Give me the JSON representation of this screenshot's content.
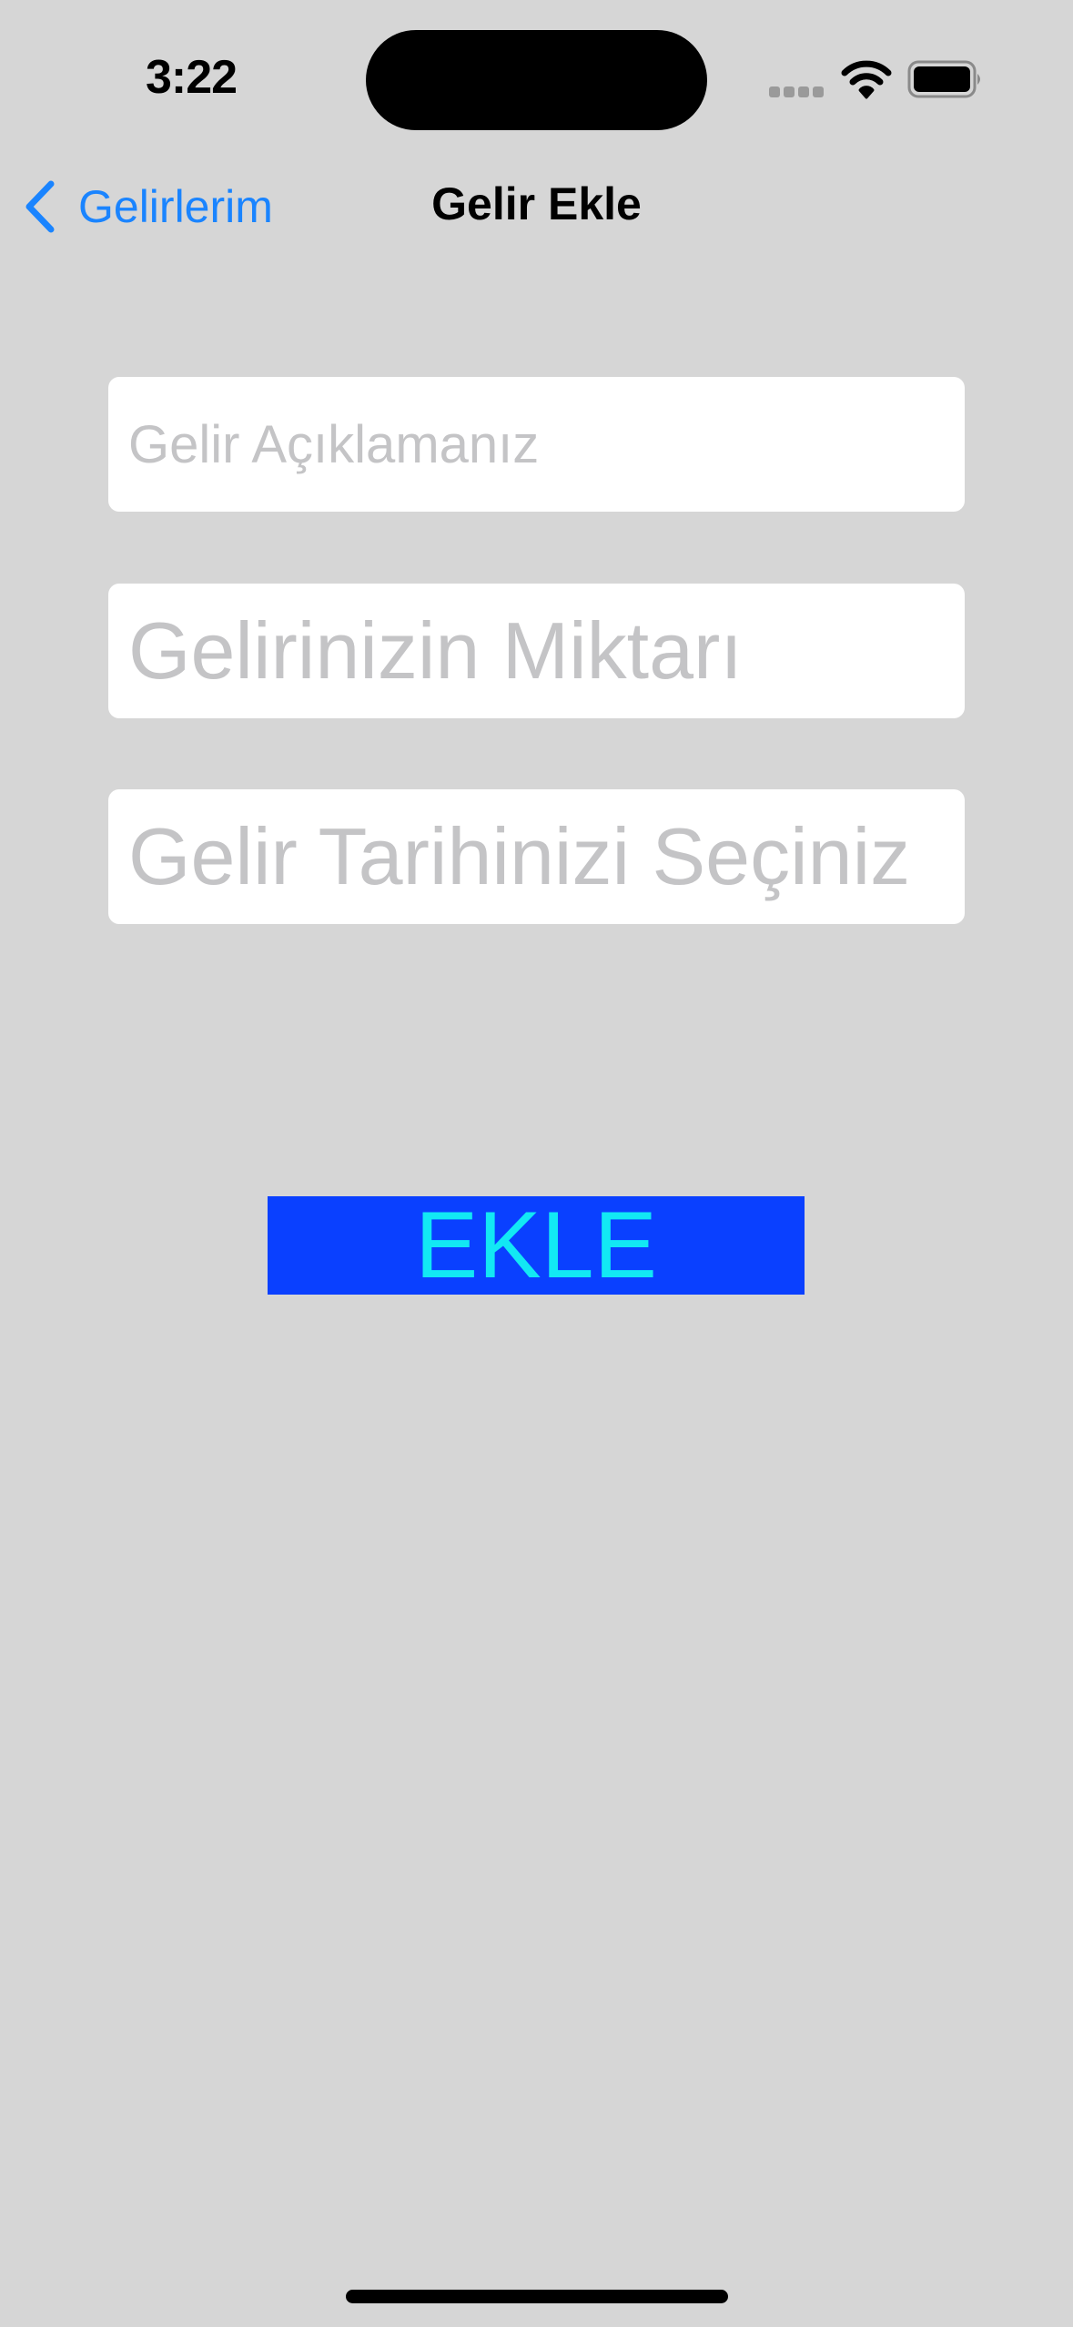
{
  "status_bar": {
    "time": "3:22"
  },
  "nav": {
    "back_label": "Gelirlerim",
    "title": "Gelir Ekle"
  },
  "form": {
    "description_placeholder": "Gelir Açıklamanız",
    "amount_placeholder": "Gelirinizin Miktarı",
    "date_placeholder": "Gelir Tarihinizi Seçiniz"
  },
  "submit": {
    "label": "EKLE"
  },
  "colors": {
    "background": "#d6d6d6",
    "accent": "#1a84ff",
    "button_background": "#0a40ff",
    "button_text": "#12e8f4",
    "placeholder": "#c4c4c6"
  },
  "icons": {
    "back": "chevron-left-icon",
    "signal": "signal-dots-icon",
    "wifi": "wifi-icon",
    "battery": "battery-icon"
  }
}
